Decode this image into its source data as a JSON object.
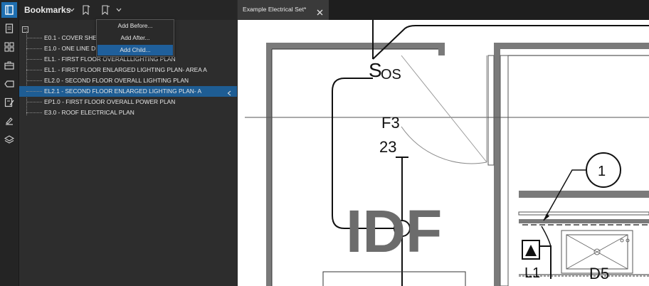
{
  "toolbar": {
    "items": [
      {
        "icon": "book-icon",
        "active": true
      },
      {
        "icon": "page-icon",
        "active": false
      },
      {
        "icon": "thumbnails-icon",
        "active": false
      },
      {
        "icon": "toolbox-icon",
        "active": false
      },
      {
        "icon": "tag-icon",
        "active": false
      },
      {
        "icon": "markup-list-icon",
        "active": false
      },
      {
        "icon": "signature-icon",
        "active": false
      },
      {
        "icon": "layers-icon",
        "active": false
      }
    ]
  },
  "panel": {
    "title": "Bookmarks",
    "bookmarks": [
      {
        "label": "E0.1 - COVER SHE",
        "selected": false
      },
      {
        "label": "E1.0 - ONE LINE DI",
        "selected": false
      },
      {
        "label": "EL1. - FIRST FLOOR OVERALLLIGHTING PLAN",
        "selected": false
      },
      {
        "label": "EL1. - FIRST FLOOR ENLARGED LIGHTING PLAN- AREA A",
        "selected": false
      },
      {
        "label": "EL2.0 - SECOND FLOOR OVERALL LIGHTING PLAN",
        "selected": false
      },
      {
        "label": "EL2.1 - SECOND FLOOR ENLARGED LIGHTING PLAN- A",
        "selected": true
      },
      {
        "label": "EP1.0 - FIRST FLOOR OVERALL POWER PLAN",
        "selected": false
      },
      {
        "label": "E3.0 - ROOF ELECTRICAL PLAN",
        "selected": false
      }
    ],
    "collapse_symbol": "−"
  },
  "menu": {
    "items": [
      {
        "label": "Add Before...",
        "highlighted": false
      },
      {
        "label": "Add After...",
        "highlighted": false
      },
      {
        "label": "Add Child...",
        "highlighted": true
      }
    ]
  },
  "document": {
    "tab_label": "Example Electrical Set*",
    "drawing_labels": {
      "switch": "S",
      "switch_type": "OS",
      "circuit_panel": "F3",
      "circuit_number": "23",
      "room_name": "IDF",
      "callout": "1",
      "fixture_tag": "L1",
      "device_tag": "D5"
    }
  }
}
